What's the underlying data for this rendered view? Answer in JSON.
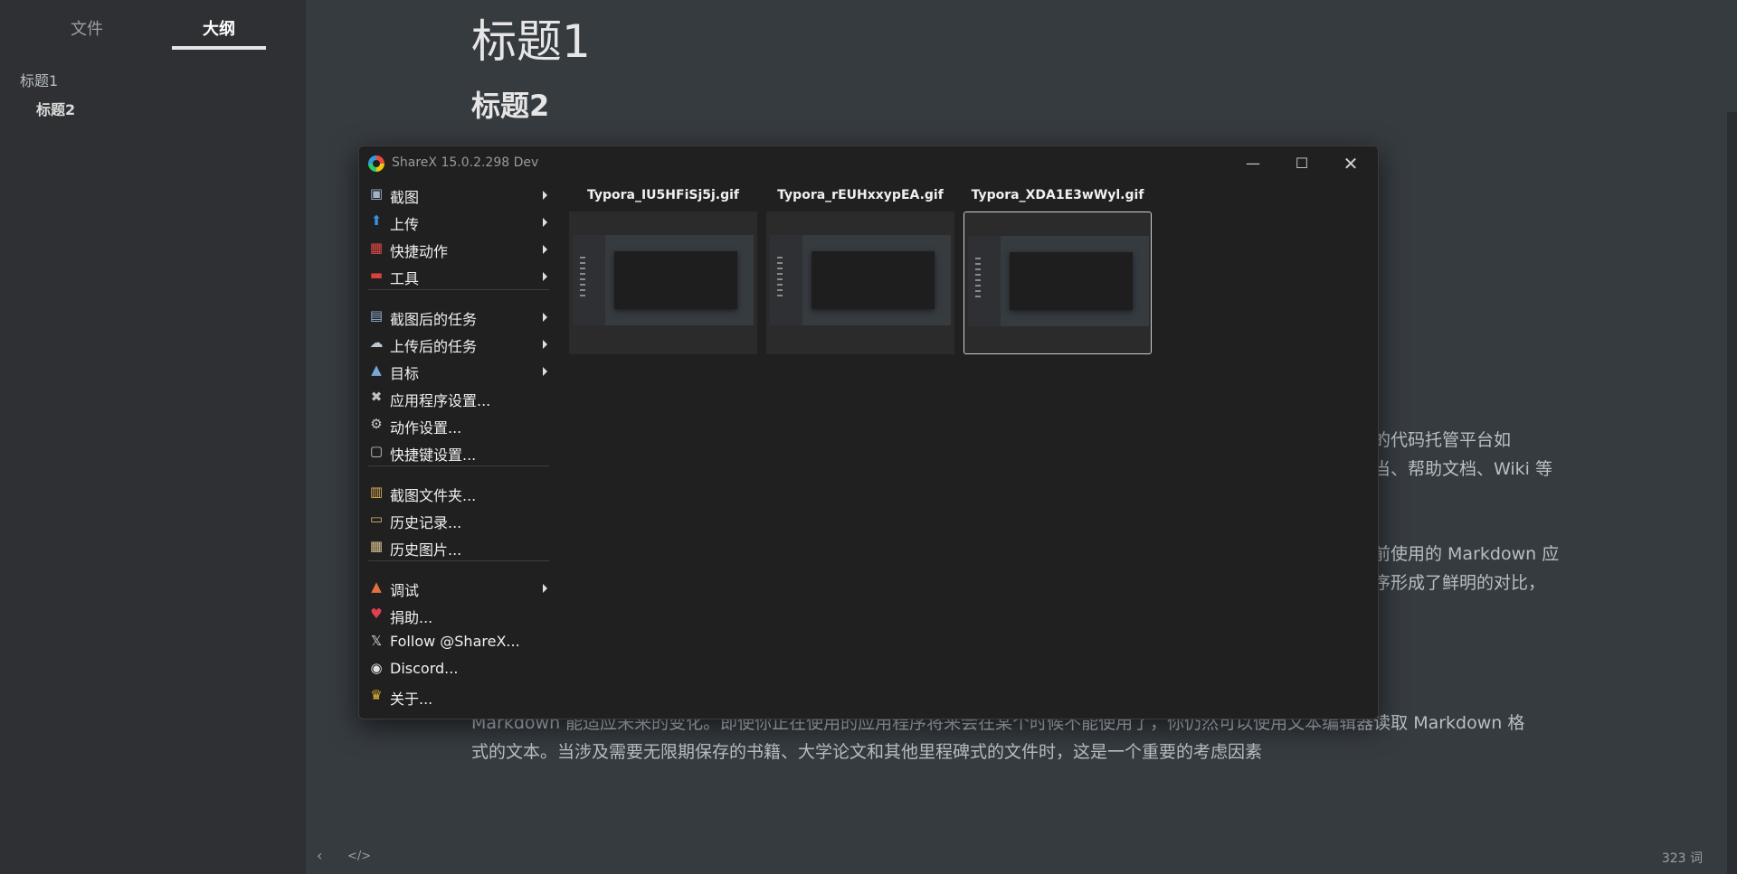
{
  "sidebar": {
    "tab_files": "文件",
    "tab_outline": "大纲",
    "outline": [
      "标题1",
      "标题2"
    ]
  },
  "editor": {
    "h1": "标题1",
    "h2": "标题2",
    "fragments": [
      "的代码托管平台如",
      "当、帮助文档、Wiki 等",
      "前使用的 Markdown 应",
      "序形成了鲜明的对比，"
    ],
    "paragraph_line1": "Markdown 能适应未来的变化。即使你正在使用的应用程序将来会在某个时候不能使用了，你仍然可以使用文本编辑器读取 Markdown 格",
    "paragraph_line2": "式的文本。当涉及需要无限期保存的书籍、大学论文和其他里程碑式的文件时，这是一个重要的考虑因素",
    "footer_back": "‹",
    "footer_code": "</>",
    "word_count": "323 词"
  },
  "sharex": {
    "title": "ShareX 15.0.2.298 Dev",
    "window_buttons": {
      "minimize": "—",
      "maximize": "☐",
      "close": "✕"
    },
    "menu": [
      {
        "label": "截图",
        "icon": "screenshot-icon",
        "glyph": "▣",
        "color": "#9fb3c8",
        "submenu": true
      },
      {
        "label": "上传",
        "icon": "upload-icon",
        "glyph": "⬆",
        "color": "#3d8fe0",
        "submenu": true
      },
      {
        "label": "快捷动作",
        "icon": "quick-actions-icon",
        "glyph": "▦",
        "color": "#e04848",
        "submenu": true
      },
      {
        "label": "工具",
        "icon": "toolbox-icon",
        "glyph": "▬",
        "color": "#d94040",
        "submenu": true
      },
      {
        "label": "截图后的任务",
        "icon": "after-capture-icon",
        "glyph": "▤",
        "color": "#8fb0d0",
        "submenu": true
      },
      {
        "label": "上传后的任务",
        "icon": "after-upload-icon",
        "glyph": "☁",
        "color": "#bfc7d0",
        "submenu": true
      },
      {
        "label": "目标",
        "icon": "destinations-icon",
        "glyph": "▲",
        "color": "#7aa7d8",
        "submenu": true
      },
      {
        "label": "应用程序设置...",
        "icon": "app-settings-icon",
        "glyph": "✖",
        "color": "#c0c0c0",
        "submenu": false
      },
      {
        "label": "动作设置...",
        "icon": "task-settings-icon",
        "glyph": "⚙",
        "color": "#c8c8c8",
        "submenu": false
      },
      {
        "label": "快捷键设置...",
        "icon": "hotkey-settings-icon",
        "glyph": "▢",
        "color": "#c8c8c8",
        "submenu": false
      },
      {
        "label": "截图文件夹...",
        "icon": "screenshots-folder-icon",
        "glyph": "▥",
        "color": "#e0b050",
        "submenu": false
      },
      {
        "label": "历史记录...",
        "icon": "history-icon",
        "glyph": "▭",
        "color": "#d8b070",
        "submenu": false
      },
      {
        "label": "历史图片...",
        "icon": "image-history-icon",
        "glyph": "▦",
        "color": "#d8c090",
        "submenu": false
      },
      {
        "label": "调试",
        "icon": "debug-icon",
        "glyph": "▲",
        "color": "#e07040",
        "submenu": true
      },
      {
        "label": "捐助...",
        "icon": "heart-icon",
        "glyph": "♥",
        "color": "#e04050",
        "submenu": false
      },
      {
        "label": "Follow @ShareX...",
        "icon": "x-logo-icon",
        "glyph": "𝕏",
        "color": "#e0e0e0",
        "submenu": false
      },
      {
        "label": "Discord...",
        "icon": "discord-icon",
        "glyph": "◉",
        "color": "#e0e0e0",
        "submenu": false
      },
      {
        "label": "关于...",
        "icon": "crown-icon",
        "glyph": "♛",
        "color": "#e0b030",
        "submenu": false
      }
    ],
    "thumbnails": [
      {
        "name": "Typora_IU5HFiSj5j.gif",
        "selected": false
      },
      {
        "name": "Typora_rEUHxxypEA.gif",
        "selected": false
      },
      {
        "name": "Typora_XDA1E3wWyl.gif",
        "selected": true
      }
    ]
  }
}
